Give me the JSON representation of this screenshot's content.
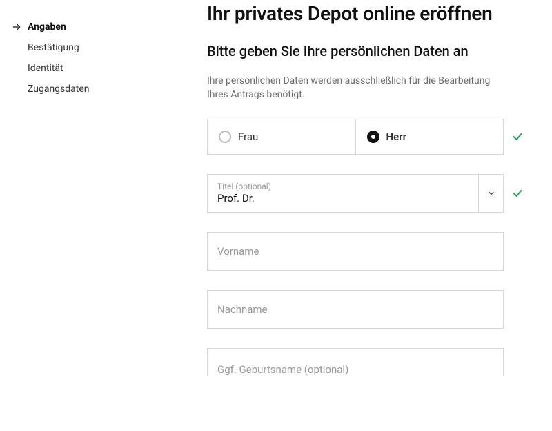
{
  "sidebar": {
    "items": [
      {
        "label": "Angaben",
        "active": true
      },
      {
        "label": "Bestätigung",
        "active": false
      },
      {
        "label": "Identität",
        "active": false
      },
      {
        "label": "Zugangsdaten",
        "active": false
      }
    ]
  },
  "header": {
    "title": "Ihr privates Depot online eröffnen",
    "subtitle": "Bitte geben Sie Ihre persönlichen Daten an",
    "hint": "Ihre persönlichen Daten werden ausschließlich für die Bearbeitung Ihres Antrags benötigt."
  },
  "form": {
    "salutation": {
      "options": [
        "Frau",
        "Herr"
      ],
      "value": "Herr",
      "valid": true
    },
    "title_select": {
      "label": "Titel (optional)",
      "value": "Prof. Dr.",
      "valid": true
    },
    "firstname_placeholder": "Vorname",
    "lastname_placeholder": "Nachname",
    "birthname_placeholder": "Ggf. Geburtsname (optional)"
  },
  "colors": {
    "border": "#d7d7d7",
    "muted": "#9a9a9a",
    "valid": "#2e9e5b"
  }
}
